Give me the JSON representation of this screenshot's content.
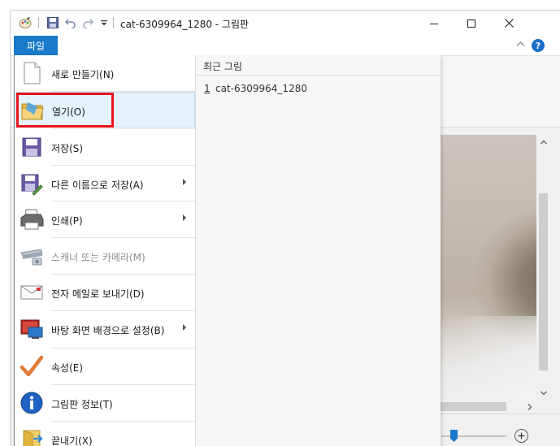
{
  "window": {
    "title": "cat-6309964_1280 - 그림판"
  },
  "ribbon": {
    "file_tab": "파일"
  },
  "file_menu": {
    "items": [
      {
        "label": "새로 만들기(N)",
        "icon": "new-file-icon"
      },
      {
        "label": "열기(O)",
        "icon": "open-folder-icon"
      },
      {
        "label": "저장(S)",
        "icon": "save-disk-icon"
      },
      {
        "label": "다른 이름으로 저장(A)",
        "icon": "save-as-icon"
      },
      {
        "label": "인쇄(P)",
        "icon": "printer-icon"
      },
      {
        "label": "스캐너 또는 카메라(M)",
        "icon": "scanner-icon"
      },
      {
        "label": "전자 메일로 보내기(D)",
        "icon": "email-icon"
      },
      {
        "label": "바탕 화면 배경으로 설정(B)",
        "icon": "desktop-background-icon"
      },
      {
        "label": "속성(E)",
        "icon": "checkmark-icon"
      },
      {
        "label": "그림판 정보(T)",
        "icon": "info-icon"
      },
      {
        "label": "끝내기(X)",
        "icon": "exit-icon"
      }
    ],
    "selected_item": "열기(O)"
  },
  "recent": {
    "title": "최근 그림",
    "items": [
      {
        "number": "1",
        "name": "cat-6309964_1280"
      }
    ]
  },
  "colors": {
    "accent": "#1979ca",
    "highlight_box": "#e8121d",
    "selected_bg": "#e5f1fb"
  }
}
